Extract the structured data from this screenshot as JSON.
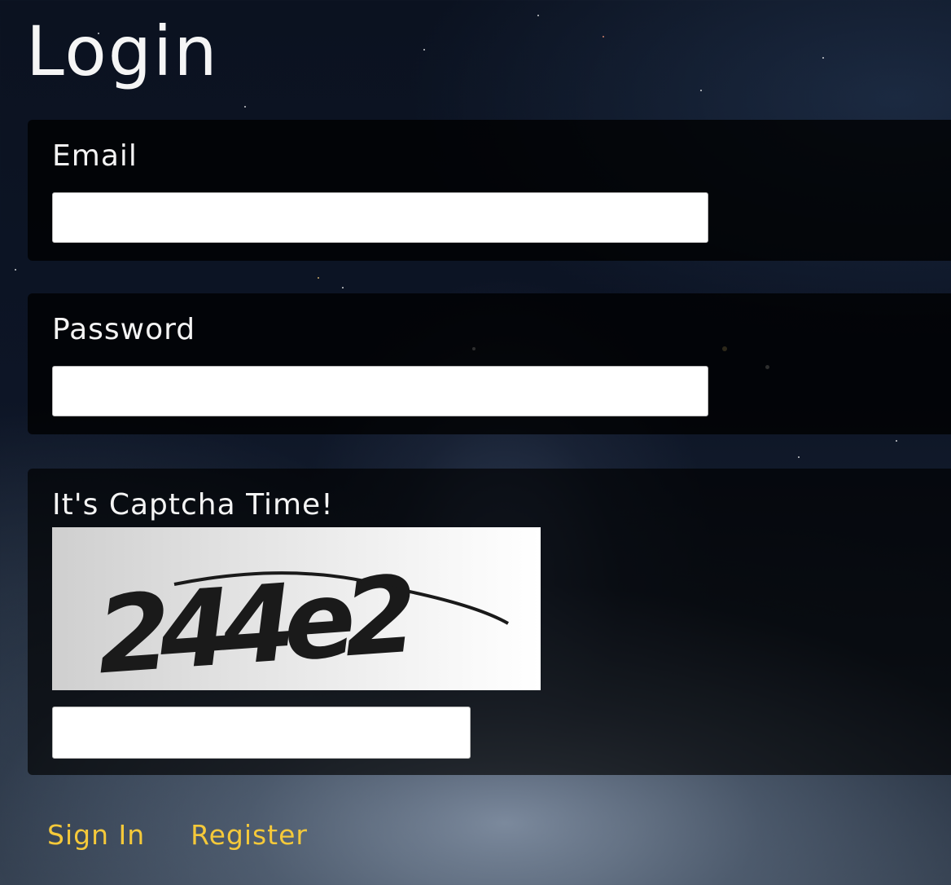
{
  "page": {
    "title": "Login"
  },
  "form": {
    "email": {
      "label": "Email",
      "value": "",
      "placeholder": ""
    },
    "password": {
      "label": "Password",
      "value": "",
      "placeholder": ""
    },
    "captcha": {
      "label": "It's Captcha Time!",
      "image_text": "244e2",
      "value": "",
      "placeholder": ""
    }
  },
  "actions": {
    "sign_in": "Sign In",
    "register": "Register"
  },
  "colors": {
    "accent": "#f5c93a",
    "panel": "#000000",
    "text": "#f2f2f2"
  }
}
